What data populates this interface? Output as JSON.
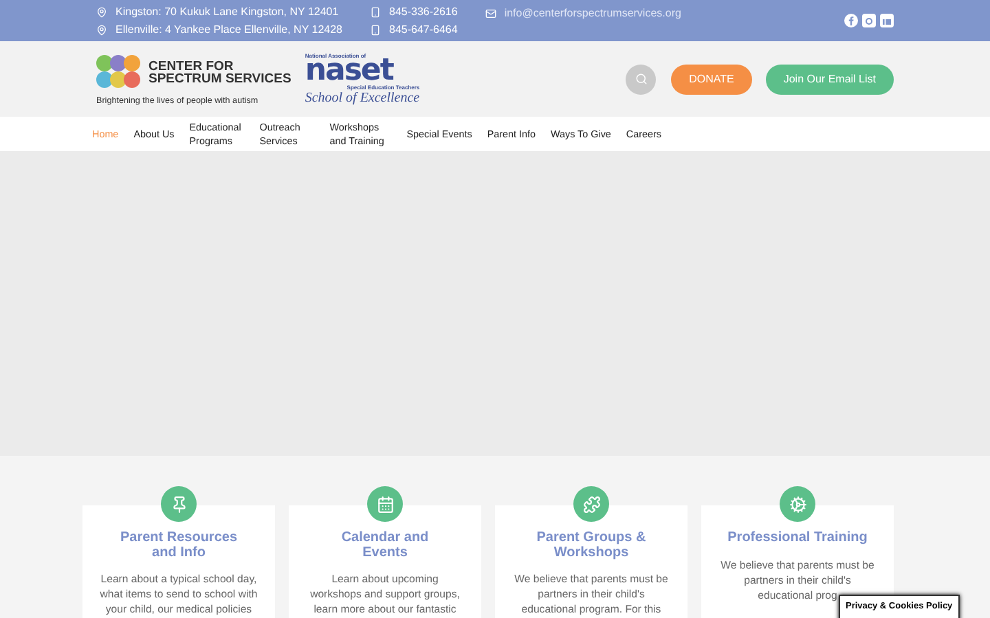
{
  "top_bar": {
    "addresses": [
      "Kingston: 70 Kukuk Lane Kingston, NY 12401",
      "Ellenville: 4 Yankee Place Ellenville, NY 12428"
    ],
    "phones": [
      "845-336-2616",
      "845-647-6464"
    ],
    "email": "info@centerforspectrumservices.org"
  },
  "logo": {
    "name_lines": [
      "CENTER FOR",
      "SPECTRUM SERVICES"
    ],
    "tagline": "Brightening the lives of people with autism"
  },
  "badge": {
    "top": "National Association of",
    "name": "naset",
    "sub": "Special Education Teachers",
    "award": "School of Excellence"
  },
  "buttons": [
    {
      "label": "DONATE",
      "color": "#f58f45"
    },
    {
      "label": "Join Our Email List",
      "color": "#5cbf8a"
    }
  ],
  "nav": [
    {
      "label": "Home",
      "selected": true
    },
    {
      "label": "About Us",
      "selected": false
    },
    {
      "label": "Educational Programs",
      "selected": false
    },
    {
      "label": "Outreach Services",
      "selected": false
    },
    {
      "label": "Workshops and Training",
      "selected": false
    },
    {
      "label": "Special Events",
      "selected": false
    },
    {
      "label": "Parent Info",
      "selected": false
    },
    {
      "label": "Ways To Give",
      "selected": false
    },
    {
      "label": "Careers",
      "selected": false
    }
  ],
  "cards": [
    {
      "kind": "pin",
      "title": "Parent Resources and Info",
      "body": "Learn about a typical school day, what items to send to school with your child, our medical policies"
    },
    {
      "kind": "calendar",
      "title": "Calendar and Events",
      "body": "Learn about upcoming workshops and support groups, learn more about our fantastic"
    },
    {
      "kind": "puzzle",
      "title": "Parent Groups & Workshops",
      "body": "We believe that parents must be partners in their child's educational program. For this"
    },
    {
      "kind": "gear",
      "title": "Professional Training",
      "body": "We believe that parents must be partners in their child's educational prog"
    }
  ],
  "cookie_notice": "Privacy & Cookies Policy"
}
